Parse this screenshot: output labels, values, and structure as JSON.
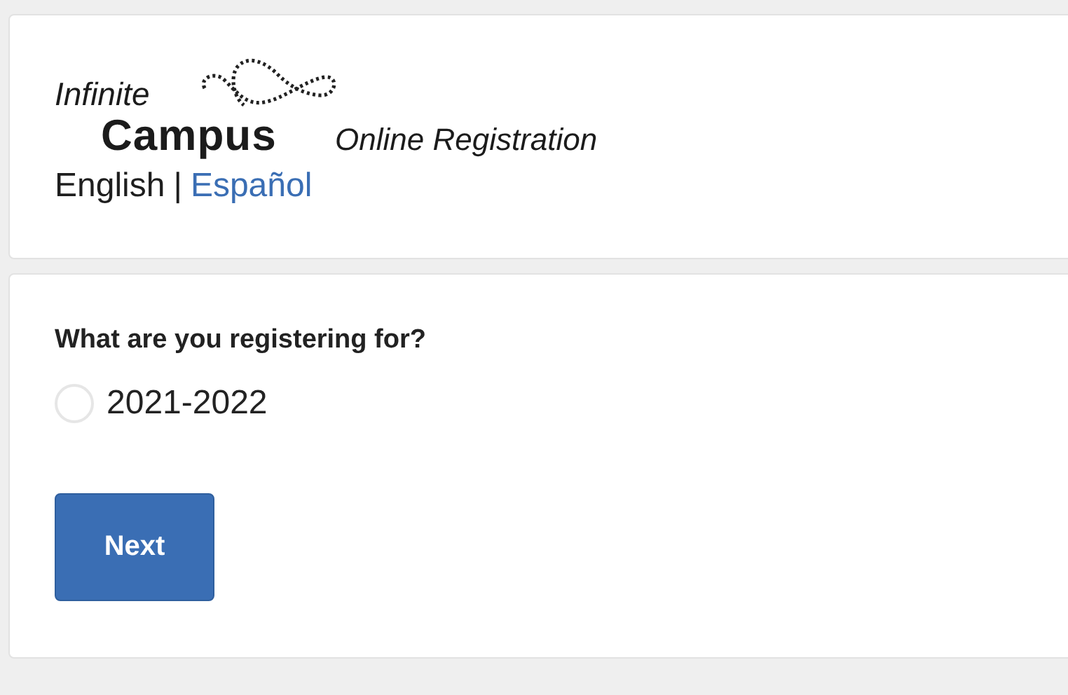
{
  "header": {
    "logo": {
      "line_1": "Infinite",
      "line_2": "Campus"
    },
    "product": "Online Registration",
    "languages": [
      {
        "label": "English",
        "selected": true
      },
      {
        "label": "Español",
        "selected": false
      }
    ],
    "separator": "|"
  },
  "form": {
    "question": "What are you registering for?",
    "options": [
      {
        "label": "2021-2022",
        "selected": false
      }
    ],
    "buttons": [
      "Next"
    ]
  }
}
